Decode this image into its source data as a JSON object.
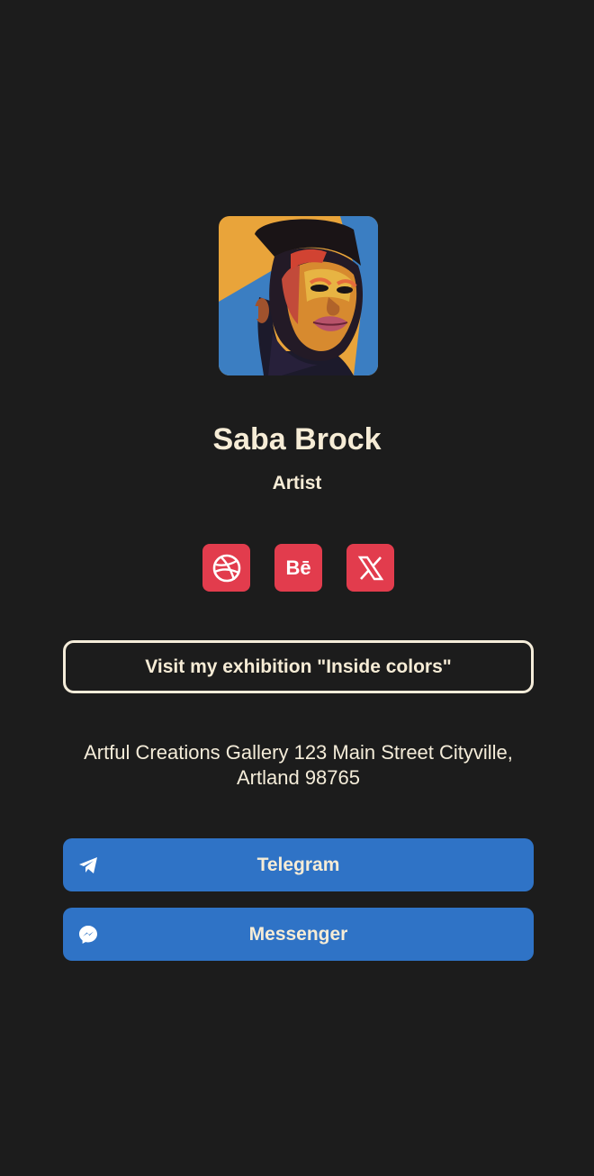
{
  "profile": {
    "name": "Saba Brock",
    "role": "Artist",
    "avatar_icon": "portrait-illustration"
  },
  "social": {
    "color": "#e23c4d",
    "items": [
      {
        "icon": "dribbble-icon"
      },
      {
        "icon": "behance-icon",
        "label": "Bē"
      },
      {
        "icon": "x-icon"
      }
    ]
  },
  "exhibition": {
    "label": "Visit my exhibition \"Inside colors\""
  },
  "address": {
    "text": "Artful Creations Gallery 123 Main Street Cityville, Artland 98765"
  },
  "contacts": {
    "color": "#2f73c6",
    "telegram": {
      "label": "Telegram",
      "icon": "telegram-icon"
    },
    "messenger": {
      "label": "Messenger",
      "icon": "messenger-icon"
    }
  }
}
